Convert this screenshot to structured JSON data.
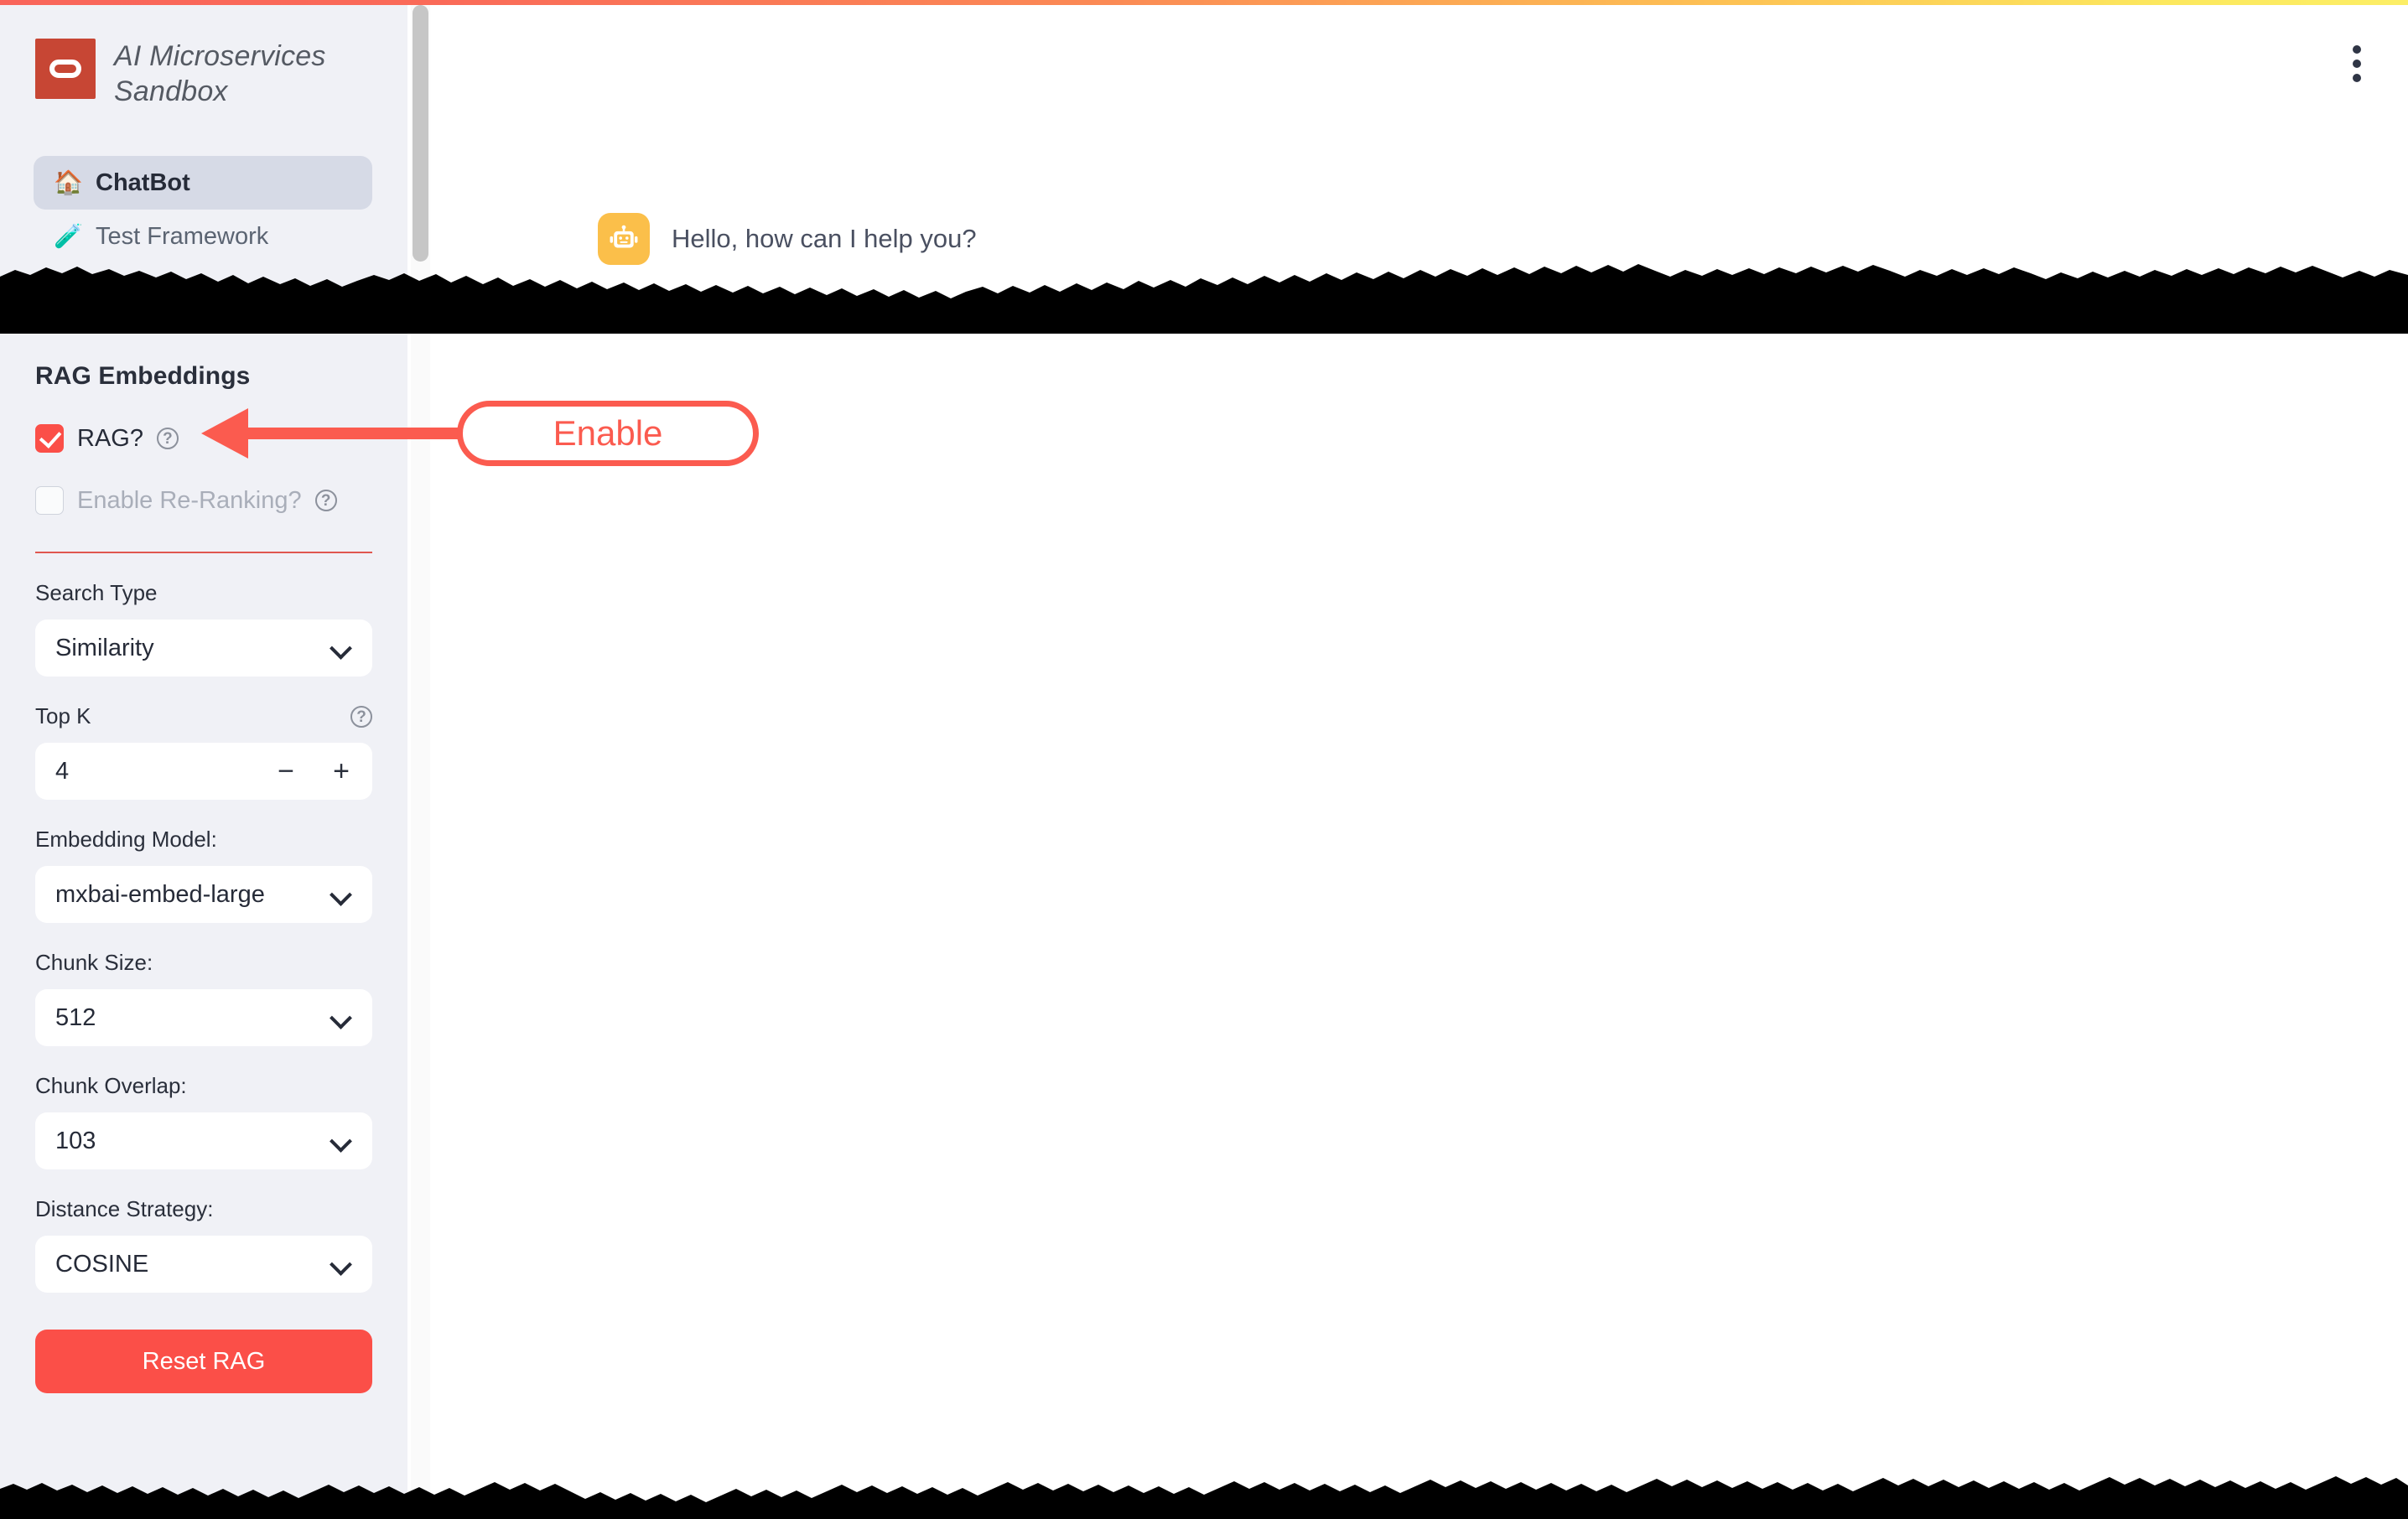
{
  "colors": {
    "accent_red": "#fb4f48",
    "annotation_red": "#fb5b4f",
    "sidebar_bg": "#f0f1f6",
    "nav_active_bg": "#d6dae6",
    "logo_bg": "#c74634",
    "bot_avatar_bg": "#fbbf4a",
    "divider": "#e0574f",
    "text_dark": "#262b38",
    "text_muted": "#a9aeb9"
  },
  "sidebar": {
    "brand": {
      "title": "AI Microservices Sandbox",
      "logo_icon": "oracle-ring-logo-icon"
    },
    "nav": [
      {
        "label": "ChatBot",
        "emoji": "🏠",
        "icon_name": "house-icon",
        "active": true
      },
      {
        "label": "Test Framework",
        "emoji": "🧪",
        "icon_name": "test-tube-icon",
        "active": false
      }
    ]
  },
  "rag_panel": {
    "heading": "RAG Embeddings",
    "checkboxes": [
      {
        "label": "RAG?",
        "checked": true,
        "disabled": false,
        "help_icon": "question-mark-icon"
      },
      {
        "label": "Enable Re-Ranking?",
        "checked": false,
        "disabled": true,
        "help_icon": "question-mark-icon"
      }
    ],
    "fields": [
      {
        "label": "Search Type",
        "value": "Similarity",
        "type": "select",
        "has_help": false
      },
      {
        "label": "Top K",
        "value": "4",
        "type": "stepper",
        "has_help": true,
        "minus": "−",
        "plus": "+"
      },
      {
        "label": "Embedding Model:",
        "value": "mxbai-embed-large",
        "type": "select",
        "has_help": false
      },
      {
        "label": "Chunk Size:",
        "value": "512",
        "type": "select",
        "has_help": false
      },
      {
        "label": "Chunk Overlap:",
        "value": "103",
        "type": "select",
        "has_help": false
      },
      {
        "label": "Distance Strategy:",
        "value": "COSINE",
        "type": "select",
        "has_help": false
      }
    ],
    "reset_button": "Reset RAG"
  },
  "main": {
    "menu_icon": "kebab-menu-icon",
    "chat": {
      "avatar_icon": "robot-avatar-icon",
      "message": "Hello, how can I help you?"
    }
  },
  "annotation": {
    "label": "Enable",
    "arrow_icon": "left-arrow-icon"
  }
}
